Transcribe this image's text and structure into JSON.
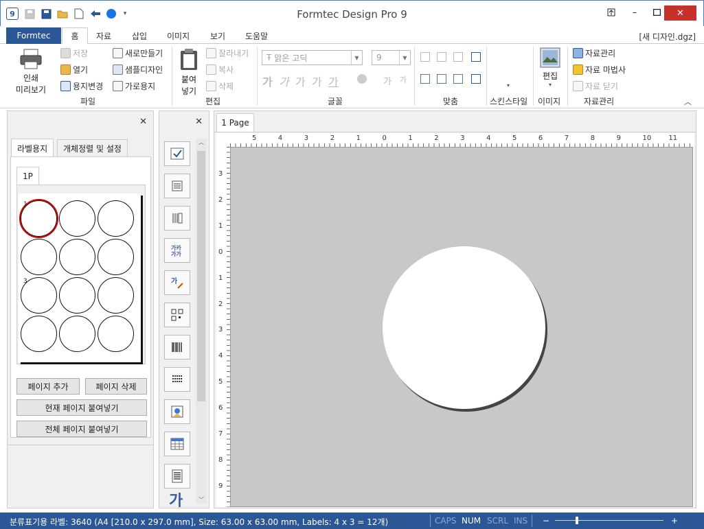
{
  "window": {
    "title": "Formtec Design Pro 9",
    "doc_name": "[새 디자인.dgz]"
  },
  "quick_access": {
    "app_icon": "9"
  },
  "tabs": {
    "formtec": "Formtec",
    "home": "홈",
    "data": "자료",
    "insert": "삽입",
    "image": "이미지",
    "view": "보기",
    "help": "도움말"
  },
  "ribbon": {
    "file": {
      "print_line1": "인쇄",
      "print_line2": "미리보기",
      "save": "저장",
      "open": "열기",
      "change_paper": "용지변경",
      "new": "새로만들기",
      "sample": "샘플디자인",
      "landscape": "가로용지",
      "group": "파일"
    },
    "edit": {
      "paste_line1": "붙여",
      "paste_line2": "넣기",
      "cut": "잘라내기",
      "copy": "복사",
      "delete": "삭제",
      "group": "편집"
    },
    "font": {
      "font_name": "맑은 고딕",
      "font_size": "9",
      "glyph": "가",
      "group": "글꼴"
    },
    "align": {
      "group": "맞춤"
    },
    "skin": {
      "group": "스킨스타일"
    },
    "image": {
      "edit_label": "편집",
      "group": "이미지"
    },
    "data_mgmt": {
      "manage": "자료관리",
      "wizard": "자료 마법사",
      "close": "자료 닫기",
      "group": "자료관리"
    }
  },
  "left_panel": {
    "tab_label": "라벨용지",
    "tab_align": "개체정렬 및 설정",
    "page_tab": "1P",
    "label_num_1": "1",
    "label_num_3": "3",
    "btn_add_page": "페이지 추가",
    "btn_del_page": "페이지 삭제",
    "btn_paste_current": "현재 페이지 붙여넣기",
    "btn_paste_all": "전체 페이지 붙여넣기"
  },
  "tools": {
    "glyph": "가"
  },
  "canvas": {
    "page_tab": "1 Page",
    "ruler_h": [
      "5",
      "4",
      "3",
      "2",
      "1",
      "0",
      "1",
      "2",
      "3",
      "4",
      "5",
      "6",
      "7",
      "8",
      "9",
      "10",
      "11"
    ],
    "ruler_v": [
      "3",
      "2",
      "1",
      "0",
      "1",
      "2",
      "3",
      "4",
      "5",
      "6",
      "7",
      "8",
      "9"
    ]
  },
  "status": {
    "info": "분류표기용 라벨: 3640 (A4 [210.0 x 297.0 mm], Size: 63.00 x 63.00 mm,  Labels: 4 x 3 = 12개)",
    "caps": "CAPS",
    "num": "NUM",
    "scrl": "SCRL",
    "ins": "INS",
    "zoom_minus": "−",
    "zoom_plus": "+"
  },
  "colors": {
    "accent": "#2b5797",
    "close": "#c7312a",
    "selection": "#cc0000"
  }
}
